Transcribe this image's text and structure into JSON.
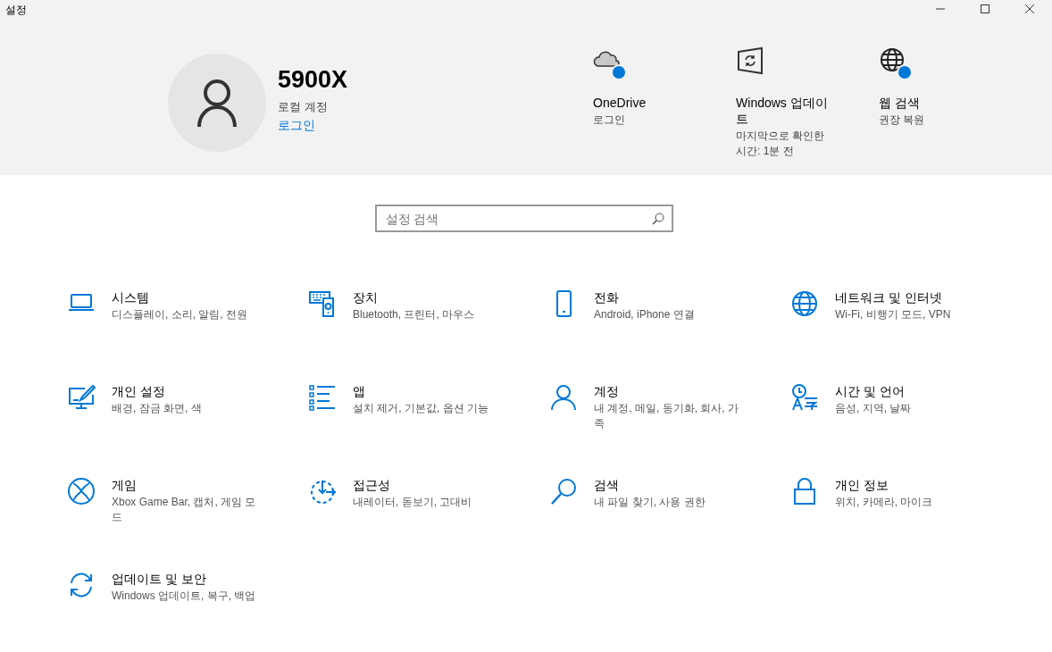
{
  "window": {
    "title": "설정"
  },
  "profile": {
    "name": "5900X",
    "account_type": "로컬 계정",
    "sign_in_link": "로그인"
  },
  "quick_links": [
    {
      "title": "OneDrive",
      "subtitle": "로그인",
      "badge": true
    },
    {
      "title": "Windows 업데이트",
      "subtitle": "마지막으로 확인한 시간: 1분 전",
      "badge": false
    },
    {
      "title": "웹 검색",
      "subtitle": "권장 복원",
      "badge": true
    }
  ],
  "search": {
    "placeholder": "설정 검색"
  },
  "categories": [
    {
      "title": "시스템",
      "description": "디스플레이, 소리, 알림, 전원"
    },
    {
      "title": "장치",
      "description": "Bluetooth, 프린터, 마우스"
    },
    {
      "title": "전화",
      "description": "Android, iPhone 연결"
    },
    {
      "title": "네트워크 및 인터넷",
      "description": "Wi-Fi, 비행기 모드, VPN"
    },
    {
      "title": "개인 설정",
      "description": "배경, 잠금 화면, 색"
    },
    {
      "title": "앱",
      "description": "설치 제거, 기본값, 옵션 기능"
    },
    {
      "title": "계정",
      "description": "내 계정, 메일, 동기화, 회사, 가족"
    },
    {
      "title": "시간 및 언어",
      "description": "음성, 지역, 날짜"
    },
    {
      "title": "게임",
      "description": "Xbox Game Bar, 캡처, 게임 모드"
    },
    {
      "title": "접근성",
      "description": "내레이터, 돋보기, 고대비"
    },
    {
      "title": "검색",
      "description": "내 파일 찾기, 사용 권한"
    },
    {
      "title": "개인 정보",
      "description": "위치, 카메라, 마이크"
    },
    {
      "title": "업데이트 및 보안",
      "description": "Windows 업데이트, 복구, 백업"
    }
  ]
}
